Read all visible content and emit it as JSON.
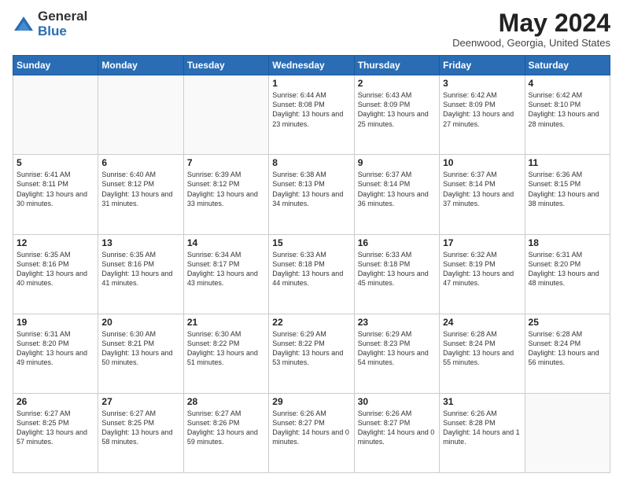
{
  "logo": {
    "general": "General",
    "blue": "Blue"
  },
  "header": {
    "month_year": "May 2024",
    "location": "Deenwood, Georgia, United States"
  },
  "days_of_week": [
    "Sunday",
    "Monday",
    "Tuesday",
    "Wednesday",
    "Thursday",
    "Friday",
    "Saturday"
  ],
  "weeks": [
    [
      {
        "day": "",
        "info": ""
      },
      {
        "day": "",
        "info": ""
      },
      {
        "day": "",
        "info": ""
      },
      {
        "day": "1",
        "info": "Sunrise: 6:44 AM\nSunset: 8:08 PM\nDaylight: 13 hours\nand 23 minutes."
      },
      {
        "day": "2",
        "info": "Sunrise: 6:43 AM\nSunset: 8:09 PM\nDaylight: 13 hours\nand 25 minutes."
      },
      {
        "day": "3",
        "info": "Sunrise: 6:42 AM\nSunset: 8:09 PM\nDaylight: 13 hours\nand 27 minutes."
      },
      {
        "day": "4",
        "info": "Sunrise: 6:42 AM\nSunset: 8:10 PM\nDaylight: 13 hours\nand 28 minutes."
      }
    ],
    [
      {
        "day": "5",
        "info": "Sunrise: 6:41 AM\nSunset: 8:11 PM\nDaylight: 13 hours\nand 30 minutes."
      },
      {
        "day": "6",
        "info": "Sunrise: 6:40 AM\nSunset: 8:12 PM\nDaylight: 13 hours\nand 31 minutes."
      },
      {
        "day": "7",
        "info": "Sunrise: 6:39 AM\nSunset: 8:12 PM\nDaylight: 13 hours\nand 33 minutes."
      },
      {
        "day": "8",
        "info": "Sunrise: 6:38 AM\nSunset: 8:13 PM\nDaylight: 13 hours\nand 34 minutes."
      },
      {
        "day": "9",
        "info": "Sunrise: 6:37 AM\nSunset: 8:14 PM\nDaylight: 13 hours\nand 36 minutes."
      },
      {
        "day": "10",
        "info": "Sunrise: 6:37 AM\nSunset: 8:14 PM\nDaylight: 13 hours\nand 37 minutes."
      },
      {
        "day": "11",
        "info": "Sunrise: 6:36 AM\nSunset: 8:15 PM\nDaylight: 13 hours\nand 38 minutes."
      }
    ],
    [
      {
        "day": "12",
        "info": "Sunrise: 6:35 AM\nSunset: 8:16 PM\nDaylight: 13 hours\nand 40 minutes."
      },
      {
        "day": "13",
        "info": "Sunrise: 6:35 AM\nSunset: 8:16 PM\nDaylight: 13 hours\nand 41 minutes."
      },
      {
        "day": "14",
        "info": "Sunrise: 6:34 AM\nSunset: 8:17 PM\nDaylight: 13 hours\nand 43 minutes."
      },
      {
        "day": "15",
        "info": "Sunrise: 6:33 AM\nSunset: 8:18 PM\nDaylight: 13 hours\nand 44 minutes."
      },
      {
        "day": "16",
        "info": "Sunrise: 6:33 AM\nSunset: 8:18 PM\nDaylight: 13 hours\nand 45 minutes."
      },
      {
        "day": "17",
        "info": "Sunrise: 6:32 AM\nSunset: 8:19 PM\nDaylight: 13 hours\nand 47 minutes."
      },
      {
        "day": "18",
        "info": "Sunrise: 6:31 AM\nSunset: 8:20 PM\nDaylight: 13 hours\nand 48 minutes."
      }
    ],
    [
      {
        "day": "19",
        "info": "Sunrise: 6:31 AM\nSunset: 8:20 PM\nDaylight: 13 hours\nand 49 minutes."
      },
      {
        "day": "20",
        "info": "Sunrise: 6:30 AM\nSunset: 8:21 PM\nDaylight: 13 hours\nand 50 minutes."
      },
      {
        "day": "21",
        "info": "Sunrise: 6:30 AM\nSunset: 8:22 PM\nDaylight: 13 hours\nand 51 minutes."
      },
      {
        "day": "22",
        "info": "Sunrise: 6:29 AM\nSunset: 8:22 PM\nDaylight: 13 hours\nand 53 minutes."
      },
      {
        "day": "23",
        "info": "Sunrise: 6:29 AM\nSunset: 8:23 PM\nDaylight: 13 hours\nand 54 minutes."
      },
      {
        "day": "24",
        "info": "Sunrise: 6:28 AM\nSunset: 8:24 PM\nDaylight: 13 hours\nand 55 minutes."
      },
      {
        "day": "25",
        "info": "Sunrise: 6:28 AM\nSunset: 8:24 PM\nDaylight: 13 hours\nand 56 minutes."
      }
    ],
    [
      {
        "day": "26",
        "info": "Sunrise: 6:27 AM\nSunset: 8:25 PM\nDaylight: 13 hours\nand 57 minutes."
      },
      {
        "day": "27",
        "info": "Sunrise: 6:27 AM\nSunset: 8:25 PM\nDaylight: 13 hours\nand 58 minutes."
      },
      {
        "day": "28",
        "info": "Sunrise: 6:27 AM\nSunset: 8:26 PM\nDaylight: 13 hours\nand 59 minutes."
      },
      {
        "day": "29",
        "info": "Sunrise: 6:26 AM\nSunset: 8:27 PM\nDaylight: 14 hours\nand 0 minutes."
      },
      {
        "day": "30",
        "info": "Sunrise: 6:26 AM\nSunset: 8:27 PM\nDaylight: 14 hours\nand 0 minutes."
      },
      {
        "day": "31",
        "info": "Sunrise: 6:26 AM\nSunset: 8:28 PM\nDaylight: 14 hours\nand 1 minute."
      },
      {
        "day": "",
        "info": ""
      }
    ]
  ]
}
